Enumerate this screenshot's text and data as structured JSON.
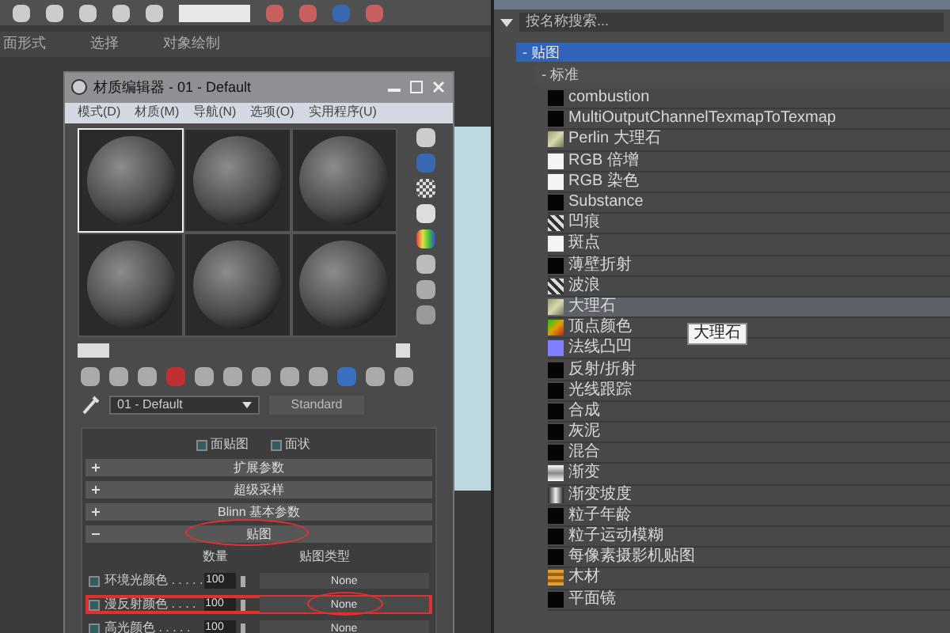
{
  "ribbon": {
    "labels": [
      "面形式",
      "选择",
      "对象绘制"
    ]
  },
  "material_editor": {
    "title": "材质编辑器 - 01 - Default",
    "menu": [
      "模式(D)",
      "材质(M)",
      "导航(N)",
      "选项(O)",
      "实用程序(U)"
    ],
    "slots": [
      {
        "selected": true
      },
      {
        "selected": false
      },
      {
        "selected": false
      },
      {
        "selected": false
      },
      {
        "selected": false
      },
      {
        "selected": false
      }
    ],
    "material_name": "01 - Default",
    "material_type": "Standard",
    "options": [
      {
        "label": "面贴图",
        "checked": false
      },
      {
        "label": "面状",
        "checked": false
      }
    ],
    "rollouts": [
      {
        "label": "扩展参数",
        "expanded": false,
        "circled": false
      },
      {
        "label": "超级采样",
        "expanded": false,
        "circled": false
      },
      {
        "label": "Blinn 基本参数",
        "expanded": false,
        "circled": false
      },
      {
        "label": "贴图",
        "expanded": true,
        "circled": true
      }
    ],
    "maps_header": {
      "amount": "数量",
      "map_type": "贴图类型"
    },
    "maps": [
      {
        "name": "环境光颜色 . . . . .",
        "checked": false,
        "amount": "100",
        "map": "None",
        "boxed": false
      },
      {
        "name": "漫反射颜色 . . . .",
        "checked": false,
        "amount": "100",
        "map": "None",
        "boxed": true
      },
      {
        "name": "高光颜色 . . . . .",
        "checked": false,
        "amount": "100",
        "map": "None",
        "boxed": false
      }
    ]
  },
  "browser": {
    "search": {
      "placeholder": "按名称搜索..."
    },
    "group": "- 贴图",
    "subgroup": "- 标准",
    "items": [
      {
        "label": "combustion",
        "kind": "black",
        "selected": false
      },
      {
        "label": "MultiOutputChannelTexmapToTexmap",
        "kind": "black",
        "selected": false
      },
      {
        "label": "Perlin 大理石",
        "kind": "marble",
        "selected": false
      },
      {
        "label": "RGB 倍增",
        "kind": "white",
        "selected": false
      },
      {
        "label": "RGB 染色",
        "kind": "white",
        "selected": false
      },
      {
        "label": "Substance",
        "kind": "black",
        "selected": false
      },
      {
        "label": "凹痕",
        "kind": "noise",
        "selected": false
      },
      {
        "label": "斑点",
        "kind": "white",
        "selected": false
      },
      {
        "label": "薄壁折射",
        "kind": "black",
        "selected": false
      },
      {
        "label": "波浪",
        "kind": "noise",
        "selected": false
      },
      {
        "label": "大理石",
        "kind": "marble",
        "selected": true
      },
      {
        "label": "顶点颜色",
        "kind": "vertex",
        "selected": false
      },
      {
        "label": "法线凸凹",
        "kind": "normal",
        "selected": false
      },
      {
        "label": "反射/折射",
        "kind": "black",
        "selected": false
      },
      {
        "label": "光线跟踪",
        "kind": "black",
        "selected": false
      },
      {
        "label": "合成",
        "kind": "black",
        "selected": false
      },
      {
        "label": "灰泥",
        "kind": "black",
        "selected": false
      },
      {
        "label": "混合",
        "kind": "black",
        "selected": false
      },
      {
        "label": "渐变",
        "kind": "gradient",
        "selected": false
      },
      {
        "label": "渐变坡度",
        "kind": "ramp",
        "selected": false
      },
      {
        "label": "粒子年龄",
        "kind": "black",
        "selected": false
      },
      {
        "label": "粒子运动模糊",
        "kind": "black",
        "selected": false
      },
      {
        "label": "每像素摄影机贴图",
        "kind": "black",
        "selected": false
      },
      {
        "label": "木材",
        "kind": "wood",
        "selected": false
      },
      {
        "label": "平面镜",
        "kind": "black",
        "selected": false
      }
    ],
    "tooltip": "大理石"
  }
}
